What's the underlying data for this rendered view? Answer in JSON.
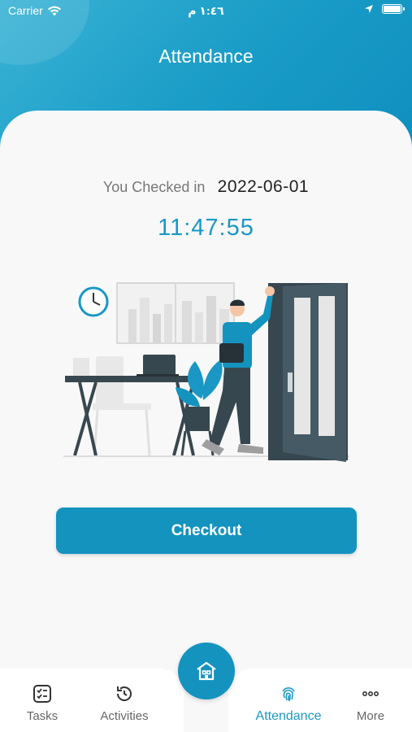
{
  "status_bar": {
    "carrier": "Carrier",
    "time": "١:٤٦ م"
  },
  "header": {
    "title": "Attendance"
  },
  "attendance": {
    "checked_in_label": "You Checked in",
    "checked_in_date": "2022-06-01",
    "checked_in_time": "11:47:55"
  },
  "actions": {
    "checkout_label": "Checkout"
  },
  "tabbar": {
    "items": [
      {
        "label": "Tasks",
        "icon": "tasks-icon"
      },
      {
        "label": "Activities",
        "icon": "history-icon"
      },
      {
        "label": "Attendance",
        "icon": "fingerprint-icon",
        "active": true
      },
      {
        "label": "More",
        "icon": "more-icon"
      }
    ],
    "center_button_icon": "home-icon"
  },
  "colors": {
    "primary": "#1593bf",
    "accent_text": "#1a97c4",
    "card_background": "#f8f8f8"
  }
}
